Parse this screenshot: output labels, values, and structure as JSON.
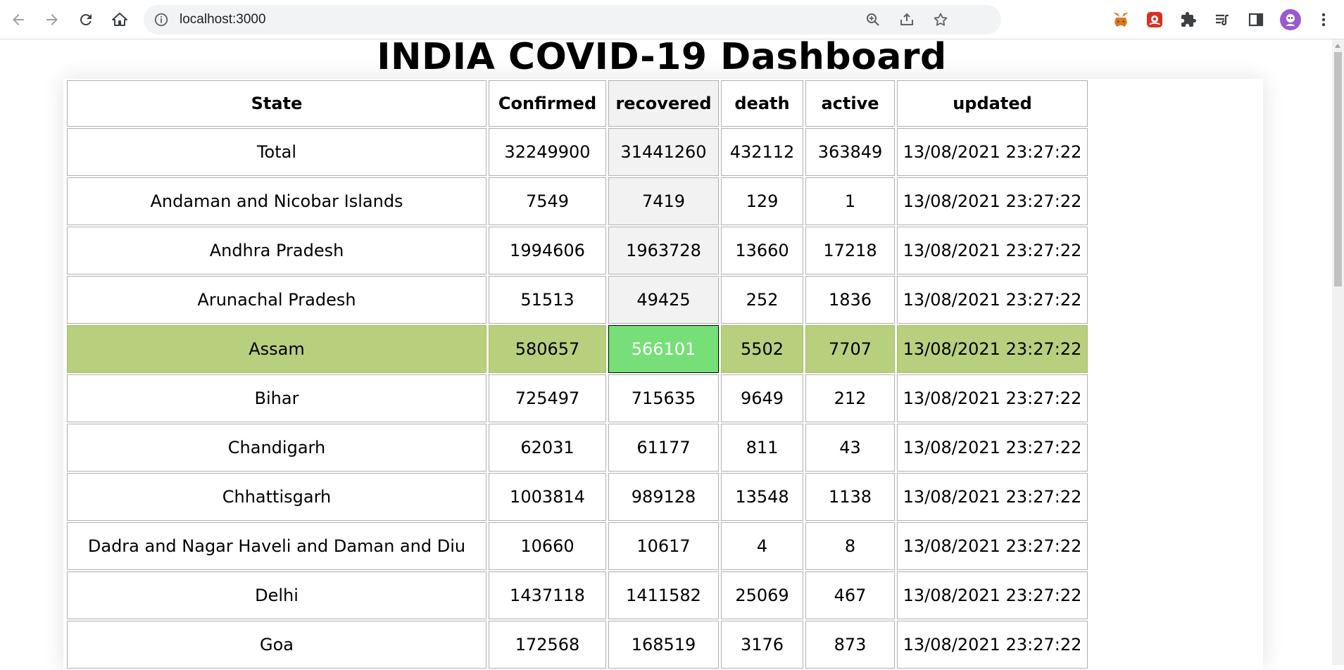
{
  "browser": {
    "url": "localhost:3000"
  },
  "page": {
    "title": "INDIA COVID-19 Dashboard"
  },
  "table": {
    "headers": {
      "state": "State",
      "confirmed": "Confirmed",
      "recovered": "recovered",
      "death": "death",
      "active": "active",
      "updated": "updated"
    },
    "highlight_color": "#b8cf7e",
    "highlight_cell_color": "#77df77",
    "rows": [
      {
        "state": "Total",
        "confirmed": "32249900",
        "recovered": "31441260",
        "death": "432112",
        "active": "363849",
        "updated": "13/08/2021 23:27:22"
      },
      {
        "state": "Andaman and Nicobar Islands",
        "confirmed": "7549",
        "recovered": "7419",
        "death": "129",
        "active": "1",
        "updated": "13/08/2021 23:27:22"
      },
      {
        "state": "Andhra Pradesh",
        "confirmed": "1994606",
        "recovered": "1963728",
        "death": "13660",
        "active": "17218",
        "updated": "13/08/2021 23:27:22"
      },
      {
        "state": "Arunachal Pradesh",
        "confirmed": "51513",
        "recovered": "49425",
        "death": "252",
        "active": "1836",
        "updated": "13/08/2021 23:27:22"
      },
      {
        "state": "Assam",
        "confirmed": "580657",
        "recovered": "566101",
        "death": "5502",
        "active": "7707",
        "updated": "13/08/2021 23:27:22"
      },
      {
        "state": "Bihar",
        "confirmed": "725497",
        "recovered": "715635",
        "death": "9649",
        "active": "212",
        "updated": "13/08/2021 23:27:22"
      },
      {
        "state": "Chandigarh",
        "confirmed": "62031",
        "recovered": "61177",
        "death": "811",
        "active": "43",
        "updated": "13/08/2021 23:27:22"
      },
      {
        "state": "Chhattisgarh",
        "confirmed": "1003814",
        "recovered": "989128",
        "death": "13548",
        "active": "1138",
        "updated": "13/08/2021 23:27:22"
      },
      {
        "state": "Dadra and Nagar Haveli and Daman and Diu",
        "confirmed": "10660",
        "recovered": "10617",
        "death": "4",
        "active": "8",
        "updated": "13/08/2021 23:27:22"
      },
      {
        "state": "Delhi",
        "confirmed": "1437118",
        "recovered": "1411582",
        "death": "25069",
        "active": "467",
        "updated": "13/08/2021 23:27:22"
      },
      {
        "state": "Goa",
        "confirmed": "172568",
        "recovered": "168519",
        "death": "3176",
        "active": "873",
        "updated": "13/08/2021 23:27:22"
      }
    ]
  }
}
